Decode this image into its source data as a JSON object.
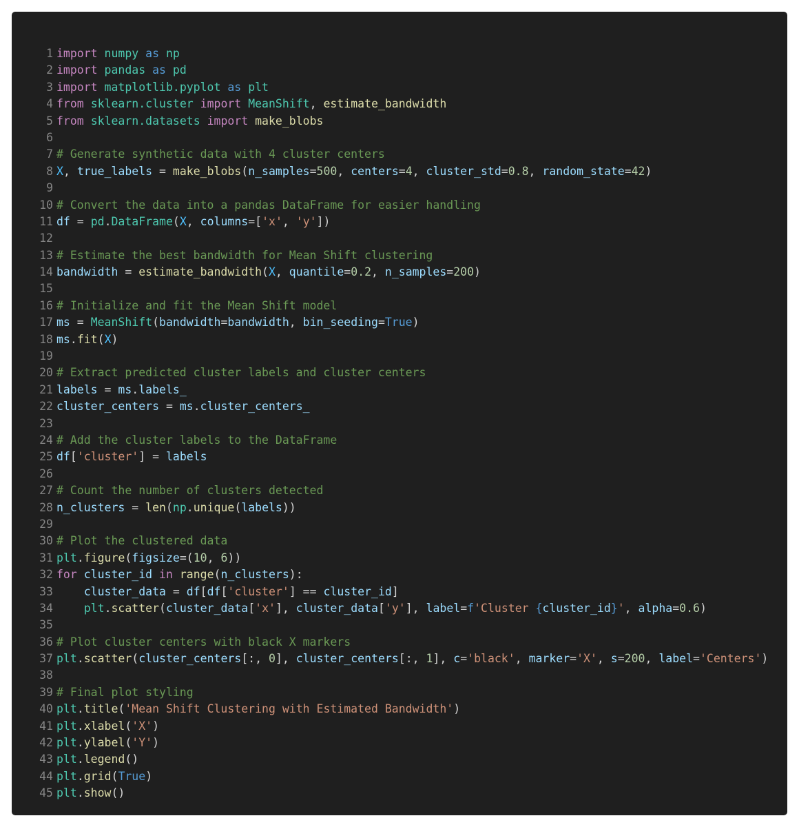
{
  "colors": {
    "background": "#1f1f1f",
    "page": "#ffffff",
    "line_number": "#858585",
    "keyword": "#c586c0",
    "keyword_alt": "#569cd6",
    "module": "#4ec9b0",
    "function": "#dcdcaa",
    "variable": "#9cdcfe",
    "constant": "#4fc1ff",
    "string": "#ce9178",
    "number": "#b5cea8",
    "comment": "#6a9955",
    "text": "#d4d4d4"
  },
  "code_lines": [
    {
      "n": "1",
      "tokens": [
        [
          "kw",
          "import"
        ],
        [
          "op",
          " "
        ],
        [
          "mod",
          "numpy"
        ],
        [
          "op",
          " "
        ],
        [
          "kw2",
          "as"
        ],
        [
          "op",
          " "
        ],
        [
          "mod",
          "np"
        ]
      ]
    },
    {
      "n": "2",
      "tokens": [
        [
          "kw",
          "import"
        ],
        [
          "op",
          " "
        ],
        [
          "mod",
          "pandas"
        ],
        [
          "op",
          " "
        ],
        [
          "kw2",
          "as"
        ],
        [
          "op",
          " "
        ],
        [
          "mod",
          "pd"
        ]
      ]
    },
    {
      "n": "3",
      "tokens": [
        [
          "kw",
          "import"
        ],
        [
          "op",
          " "
        ],
        [
          "mod",
          "matplotlib.pyplot"
        ],
        [
          "op",
          " "
        ],
        [
          "kw2",
          "as"
        ],
        [
          "op",
          " "
        ],
        [
          "mod",
          "plt"
        ]
      ]
    },
    {
      "n": "4",
      "tokens": [
        [
          "kw",
          "from"
        ],
        [
          "op",
          " "
        ],
        [
          "mod",
          "sklearn.cluster"
        ],
        [
          "op",
          " "
        ],
        [
          "kw",
          "import"
        ],
        [
          "op",
          " "
        ],
        [
          "cls",
          "MeanShift"
        ],
        [
          "op",
          ", "
        ],
        [
          "fn",
          "estimate_bandwidth"
        ]
      ]
    },
    {
      "n": "5",
      "tokens": [
        [
          "kw",
          "from"
        ],
        [
          "op",
          " "
        ],
        [
          "mod",
          "sklearn.datasets"
        ],
        [
          "op",
          " "
        ],
        [
          "kw",
          "import"
        ],
        [
          "op",
          " "
        ],
        [
          "fn",
          "make_blobs"
        ]
      ]
    },
    {
      "n": "6",
      "tokens": []
    },
    {
      "n": "7",
      "tokens": [
        [
          "com",
          "# Generate synthetic data with 4 cluster centers"
        ]
      ]
    },
    {
      "n": "8",
      "tokens": [
        [
          "const",
          "X"
        ],
        [
          "op",
          ", "
        ],
        [
          "var",
          "true_labels"
        ],
        [
          "op",
          " = "
        ],
        [
          "fn",
          "make_blobs"
        ],
        [
          "op",
          "("
        ],
        [
          "var",
          "n_samples"
        ],
        [
          "op",
          "="
        ],
        [
          "num",
          "500"
        ],
        [
          "op",
          ", "
        ],
        [
          "var",
          "centers"
        ],
        [
          "op",
          "="
        ],
        [
          "num",
          "4"
        ],
        [
          "op",
          ", "
        ],
        [
          "var",
          "cluster_std"
        ],
        [
          "op",
          "="
        ],
        [
          "num",
          "0.8"
        ],
        [
          "op",
          ", "
        ],
        [
          "var",
          "random_state"
        ],
        [
          "op",
          "="
        ],
        [
          "num",
          "42"
        ],
        [
          "op",
          ")"
        ]
      ]
    },
    {
      "n": "9",
      "tokens": []
    },
    {
      "n": "10",
      "tokens": [
        [
          "com",
          "# Convert the data into a pandas DataFrame for easier handling"
        ]
      ]
    },
    {
      "n": "11",
      "tokens": [
        [
          "var",
          "df"
        ],
        [
          "op",
          " = "
        ],
        [
          "mod",
          "pd"
        ],
        [
          "op",
          "."
        ],
        [
          "cls",
          "DataFrame"
        ],
        [
          "op",
          "("
        ],
        [
          "const",
          "X"
        ],
        [
          "op",
          ", "
        ],
        [
          "var",
          "columns"
        ],
        [
          "op",
          "=["
        ],
        [
          "str",
          "'x'"
        ],
        [
          "op",
          ", "
        ],
        [
          "str",
          "'y'"
        ],
        [
          "op",
          "])"
        ]
      ]
    },
    {
      "n": "12",
      "tokens": []
    },
    {
      "n": "13",
      "tokens": [
        [
          "com",
          "# Estimate the best bandwidth for Mean Shift clustering"
        ]
      ]
    },
    {
      "n": "14",
      "tokens": [
        [
          "var",
          "bandwidth"
        ],
        [
          "op",
          " = "
        ],
        [
          "fn",
          "estimate_bandwidth"
        ],
        [
          "op",
          "("
        ],
        [
          "const",
          "X"
        ],
        [
          "op",
          ", "
        ],
        [
          "var",
          "quantile"
        ],
        [
          "op",
          "="
        ],
        [
          "num",
          "0.2"
        ],
        [
          "op",
          ", "
        ],
        [
          "var",
          "n_samples"
        ],
        [
          "op",
          "="
        ],
        [
          "num",
          "200"
        ],
        [
          "op",
          ")"
        ]
      ]
    },
    {
      "n": "15",
      "tokens": []
    },
    {
      "n": "16",
      "tokens": [
        [
          "com",
          "# Initialize and fit the Mean Shift model"
        ]
      ]
    },
    {
      "n": "17",
      "tokens": [
        [
          "var",
          "ms"
        ],
        [
          "op",
          " = "
        ],
        [
          "cls",
          "MeanShift"
        ],
        [
          "op",
          "("
        ],
        [
          "var",
          "bandwidth"
        ],
        [
          "op",
          "="
        ],
        [
          "var",
          "bandwidth"
        ],
        [
          "op",
          ", "
        ],
        [
          "var",
          "bin_seeding"
        ],
        [
          "op",
          "="
        ],
        [
          "bool",
          "True"
        ],
        [
          "op",
          ")"
        ]
      ]
    },
    {
      "n": "18",
      "tokens": [
        [
          "var",
          "ms"
        ],
        [
          "op",
          "."
        ],
        [
          "fn",
          "fit"
        ],
        [
          "op",
          "("
        ],
        [
          "const",
          "X"
        ],
        [
          "op",
          ")"
        ]
      ]
    },
    {
      "n": "19",
      "tokens": []
    },
    {
      "n": "20",
      "tokens": [
        [
          "com",
          "# Extract predicted cluster labels and cluster centers"
        ]
      ]
    },
    {
      "n": "21",
      "tokens": [
        [
          "var",
          "labels"
        ],
        [
          "op",
          " = "
        ],
        [
          "var",
          "ms"
        ],
        [
          "op",
          "."
        ],
        [
          "var",
          "labels_"
        ]
      ]
    },
    {
      "n": "22",
      "tokens": [
        [
          "var",
          "cluster_centers"
        ],
        [
          "op",
          " = "
        ],
        [
          "var",
          "ms"
        ],
        [
          "op",
          "."
        ],
        [
          "var",
          "cluster_centers_"
        ]
      ]
    },
    {
      "n": "23",
      "tokens": []
    },
    {
      "n": "24",
      "tokens": [
        [
          "com",
          "# Add the cluster labels to the DataFrame"
        ]
      ]
    },
    {
      "n": "25",
      "tokens": [
        [
          "var",
          "df"
        ],
        [
          "op",
          "["
        ],
        [
          "str",
          "'cluster'"
        ],
        [
          "op",
          "] = "
        ],
        [
          "var",
          "labels"
        ]
      ]
    },
    {
      "n": "26",
      "tokens": []
    },
    {
      "n": "27",
      "tokens": [
        [
          "com",
          "# Count the number of clusters detected"
        ]
      ]
    },
    {
      "n": "28",
      "tokens": [
        [
          "var",
          "n_clusters"
        ],
        [
          "op",
          " = "
        ],
        [
          "fn",
          "len"
        ],
        [
          "op",
          "("
        ],
        [
          "mod",
          "np"
        ],
        [
          "op",
          "."
        ],
        [
          "fn",
          "unique"
        ],
        [
          "op",
          "("
        ],
        [
          "var",
          "labels"
        ],
        [
          "op",
          "))"
        ]
      ]
    },
    {
      "n": "29",
      "tokens": []
    },
    {
      "n": "30",
      "tokens": [
        [
          "com",
          "# Plot the clustered data"
        ]
      ]
    },
    {
      "n": "31",
      "tokens": [
        [
          "mod",
          "plt"
        ],
        [
          "op",
          "."
        ],
        [
          "fn",
          "figure"
        ],
        [
          "op",
          "("
        ],
        [
          "var",
          "figsize"
        ],
        [
          "op",
          "=("
        ],
        [
          "num",
          "10"
        ],
        [
          "op",
          ", "
        ],
        [
          "num",
          "6"
        ],
        [
          "op",
          "))"
        ]
      ]
    },
    {
      "n": "32",
      "tokens": [
        [
          "kw",
          "for"
        ],
        [
          "op",
          " "
        ],
        [
          "var",
          "cluster_id"
        ],
        [
          "op",
          " "
        ],
        [
          "kw",
          "in"
        ],
        [
          "op",
          " "
        ],
        [
          "fn",
          "range"
        ],
        [
          "op",
          "("
        ],
        [
          "var",
          "n_clusters"
        ],
        [
          "op",
          "):"
        ]
      ]
    },
    {
      "n": "33",
      "tokens": [
        [
          "op",
          "    "
        ],
        [
          "var",
          "cluster_data"
        ],
        [
          "op",
          " = "
        ],
        [
          "var",
          "df"
        ],
        [
          "op",
          "["
        ],
        [
          "var",
          "df"
        ],
        [
          "op",
          "["
        ],
        [
          "str",
          "'cluster'"
        ],
        [
          "op",
          "] == "
        ],
        [
          "var",
          "cluster_id"
        ],
        [
          "op",
          "]"
        ]
      ]
    },
    {
      "n": "34",
      "tokens": [
        [
          "op",
          "    "
        ],
        [
          "mod",
          "plt"
        ],
        [
          "op",
          "."
        ],
        [
          "fn",
          "scatter"
        ],
        [
          "op",
          "("
        ],
        [
          "var",
          "cluster_data"
        ],
        [
          "op",
          "["
        ],
        [
          "str",
          "'x'"
        ],
        [
          "op",
          "], "
        ],
        [
          "var",
          "cluster_data"
        ],
        [
          "op",
          "["
        ],
        [
          "str",
          "'y'"
        ],
        [
          "op",
          "], "
        ],
        [
          "var",
          "label"
        ],
        [
          "op",
          "="
        ],
        [
          "kw2",
          "f"
        ],
        [
          "str",
          "'Cluster "
        ],
        [
          "kw2",
          "{"
        ],
        [
          "var",
          "cluster_id"
        ],
        [
          "kw2",
          "}"
        ],
        [
          "str",
          "'"
        ],
        [
          "op",
          ", "
        ],
        [
          "var",
          "alpha"
        ],
        [
          "op",
          "="
        ],
        [
          "num",
          "0.6"
        ],
        [
          "op",
          ")"
        ]
      ]
    },
    {
      "n": "35",
      "tokens": []
    },
    {
      "n": "36",
      "tokens": [
        [
          "com",
          "# Plot cluster centers with black X markers"
        ]
      ]
    },
    {
      "n": "37",
      "tokens": [
        [
          "mod",
          "plt"
        ],
        [
          "op",
          "."
        ],
        [
          "fn",
          "scatter"
        ],
        [
          "op",
          "("
        ],
        [
          "var",
          "cluster_centers"
        ],
        [
          "op",
          "[:, "
        ],
        [
          "num",
          "0"
        ],
        [
          "op",
          "], "
        ],
        [
          "var",
          "cluster_centers"
        ],
        [
          "op",
          "[:, "
        ],
        [
          "num",
          "1"
        ],
        [
          "op",
          "], "
        ],
        [
          "var",
          "c"
        ],
        [
          "op",
          "="
        ],
        [
          "str",
          "'black'"
        ],
        [
          "op",
          ", "
        ],
        [
          "var",
          "marker"
        ],
        [
          "op",
          "="
        ],
        [
          "str",
          "'X'"
        ],
        [
          "op",
          ", "
        ],
        [
          "var",
          "s"
        ],
        [
          "op",
          "="
        ],
        [
          "num",
          "200"
        ],
        [
          "op",
          ", "
        ],
        [
          "var",
          "label"
        ],
        [
          "op",
          "="
        ],
        [
          "str",
          "'Centers'"
        ],
        [
          "op",
          ")"
        ]
      ]
    },
    {
      "n": "38",
      "tokens": []
    },
    {
      "n": "39",
      "tokens": [
        [
          "com",
          "# Final plot styling"
        ]
      ]
    },
    {
      "n": "40",
      "tokens": [
        [
          "mod",
          "plt"
        ],
        [
          "op",
          "."
        ],
        [
          "fn",
          "title"
        ],
        [
          "op",
          "("
        ],
        [
          "str",
          "'Mean Shift Clustering with Estimated Bandwidth'"
        ],
        [
          "op",
          ")"
        ]
      ]
    },
    {
      "n": "41",
      "tokens": [
        [
          "mod",
          "plt"
        ],
        [
          "op",
          "."
        ],
        [
          "fn",
          "xlabel"
        ],
        [
          "op",
          "("
        ],
        [
          "str",
          "'X'"
        ],
        [
          "op",
          ")"
        ]
      ]
    },
    {
      "n": "42",
      "tokens": [
        [
          "mod",
          "plt"
        ],
        [
          "op",
          "."
        ],
        [
          "fn",
          "ylabel"
        ],
        [
          "op",
          "("
        ],
        [
          "str",
          "'Y'"
        ],
        [
          "op",
          ")"
        ]
      ]
    },
    {
      "n": "43",
      "tokens": [
        [
          "mod",
          "plt"
        ],
        [
          "op",
          "."
        ],
        [
          "fn",
          "legend"
        ],
        [
          "op",
          "()"
        ]
      ]
    },
    {
      "n": "44",
      "tokens": [
        [
          "mod",
          "plt"
        ],
        [
          "op",
          "."
        ],
        [
          "fn",
          "grid"
        ],
        [
          "op",
          "("
        ],
        [
          "bool",
          "True"
        ],
        [
          "op",
          ")"
        ]
      ]
    },
    {
      "n": "45",
      "tokens": [
        [
          "mod",
          "plt"
        ],
        [
          "op",
          "."
        ],
        [
          "fn",
          "show"
        ],
        [
          "op",
          "()"
        ]
      ]
    }
  ]
}
